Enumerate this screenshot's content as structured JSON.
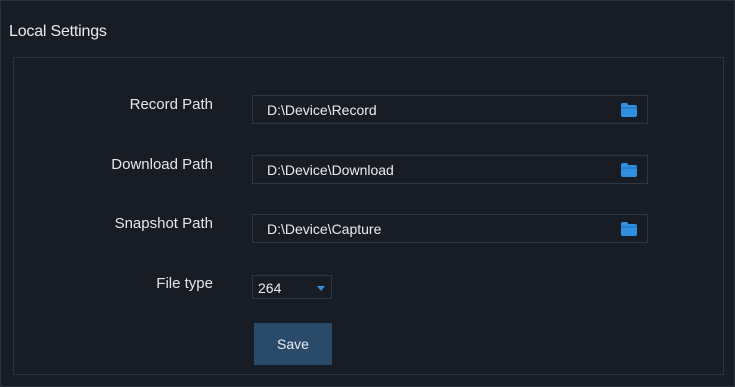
{
  "window": {
    "title": "Local Settings"
  },
  "form": {
    "record_path": {
      "label": "Record Path",
      "value": "D:\\Device\\Record",
      "icon": "folder-icon"
    },
    "download_path": {
      "label": "Download Path",
      "value": "D:\\Device\\Download",
      "icon": "folder-icon"
    },
    "snapshot_path": {
      "label": "Snapshot Path",
      "value": "D:\\Device\\Capture",
      "icon": "folder-icon"
    },
    "file_type": {
      "label": "File type",
      "selected": "264"
    },
    "save_label": "Save"
  },
  "colors": {
    "background": "#181d25",
    "accent": "#2f8fe0",
    "button": "#2a4a6a"
  }
}
